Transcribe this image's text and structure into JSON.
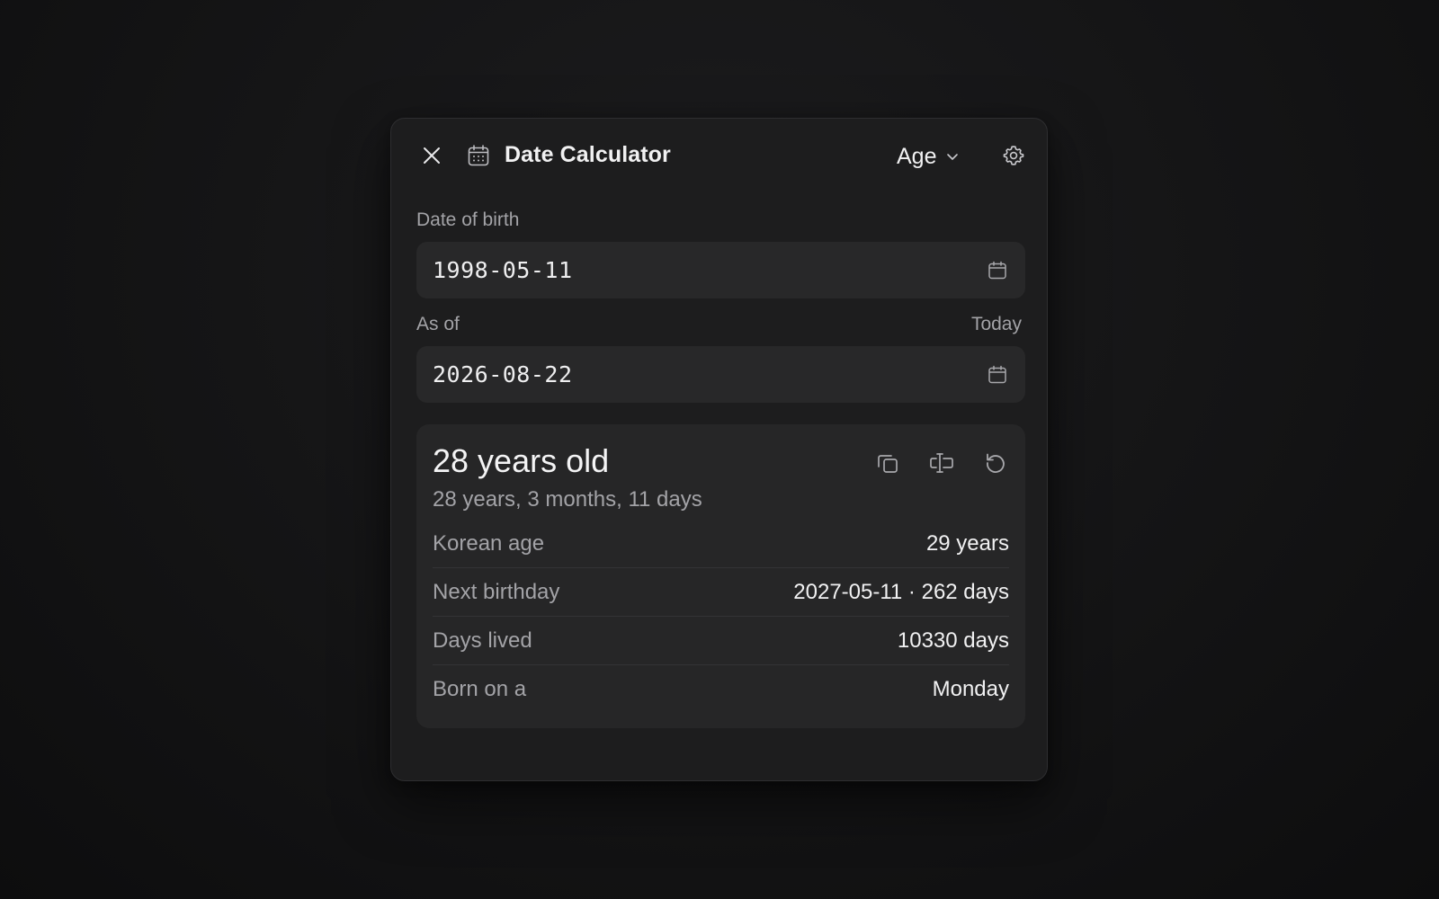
{
  "header": {
    "title": "Date Calculator",
    "mode": "Age",
    "icons": {
      "close": "close-icon",
      "title": "calendar-icon",
      "mode_dropdown": "chevron-down-icon",
      "settings": "gear-icon"
    }
  },
  "birth": {
    "label": "Date of birth",
    "value": "1998-05-11"
  },
  "as_of": {
    "label": "As of",
    "today_label": "Today",
    "value": "2026-08-22"
  },
  "result": {
    "headline": "28 years old",
    "detail": "28 years, 3 months, 11 days",
    "actions": [
      "copy-icon",
      "compare-icon",
      "reset-icon"
    ],
    "rows": [
      {
        "label": "Korean age",
        "value": "29 years"
      },
      {
        "label": "Next birthday",
        "value": "2027-05-11 · 262 days"
      },
      {
        "label": "Days lived",
        "value": "10330 days"
      },
      {
        "label": "Born on a",
        "value": "Monday"
      }
    ]
  },
  "colors": {
    "background": "#141415",
    "panel": "#1d1d1e",
    "field": "#282829",
    "card": "#262627",
    "text_primary": "#f1f1f2",
    "text_secondary": "#a3a3a7"
  }
}
